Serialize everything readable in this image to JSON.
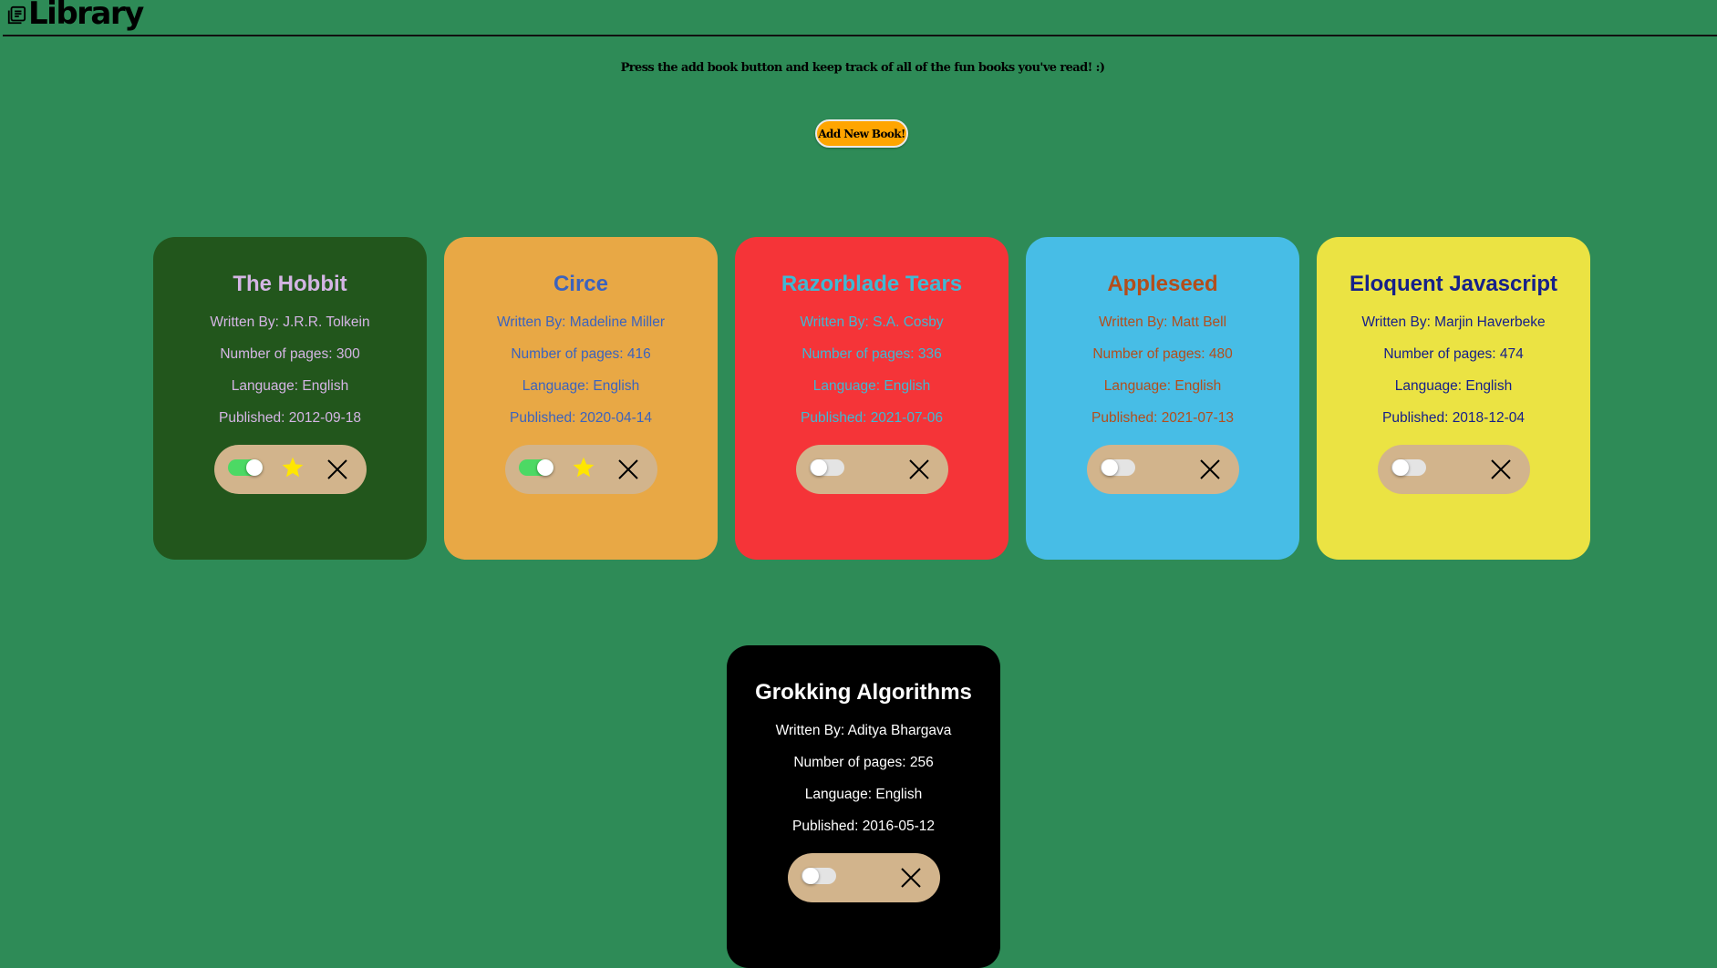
{
  "header": {
    "title": "Library"
  },
  "intro": {
    "text": "Press the add book button and keep track of all of the fun books you've read! :)"
  },
  "add_button": {
    "label": "Add New Book!"
  },
  "books": [
    {
      "title": "The Hobbit",
      "author": "Written By: J.R.R. Tolkein",
      "pages": "Number of pages: 300",
      "language": "Language: English",
      "published": "Published: 2012-09-18",
      "read": true,
      "favorite": true,
      "bg_color": "#22561c",
      "text_color": "#d4b5e4"
    },
    {
      "title": "Circe",
      "author": "Written By: Madeline Miller",
      "pages": "Number of pages: 416",
      "language": "Language: English",
      "published": "Published: 2020-04-14",
      "read": true,
      "favorite": true,
      "bg_color": "#e8a845",
      "text_color": "#3c63bd"
    },
    {
      "title": "Razorblade Tears",
      "author": "Written By: S.A. Cosby",
      "pages": "Number of pages: 336",
      "language": "Language: English",
      "published": "Published: 2021-07-06",
      "read": false,
      "favorite": false,
      "bg_color": "#f53438",
      "text_color": "#3fb9d4"
    },
    {
      "title": "Appleseed",
      "author": "Written By: Matt Bell",
      "pages": "Number of pages: 480",
      "language": "Language: English",
      "published": "Published: 2021-07-13",
      "read": false,
      "favorite": false,
      "bg_color": "#47bde6",
      "text_color": "#b34e1c"
    },
    {
      "title": "Eloquent Javascript",
      "author": "Written By: Marjin Haverbeke",
      "pages": "Number of pages: 474",
      "language": "Language: English",
      "published": "Published: 2018-12-04",
      "read": false,
      "favorite": false,
      "bg_color": "#ebe343",
      "text_color": "#16208a"
    },
    {
      "title": "Grokking Algorithms",
      "author": "Written By: Aditya Bhargava",
      "pages": "Number of pages: 256",
      "language": "Language: English",
      "published": "Published: 2016-05-12",
      "read": false,
      "favorite": false,
      "bg_color": "#000000",
      "text_color": "#ffffff"
    }
  ],
  "icons": {
    "logo": "book-stack-icon",
    "favorite": "star-icon",
    "remove": "close-icon"
  },
  "colors": {
    "page_background": "#2e8b57",
    "button_background": "#ffa500",
    "controls_background": "#d2b48c",
    "toggle_on": "#4cd964",
    "star": "#ffe600"
  }
}
